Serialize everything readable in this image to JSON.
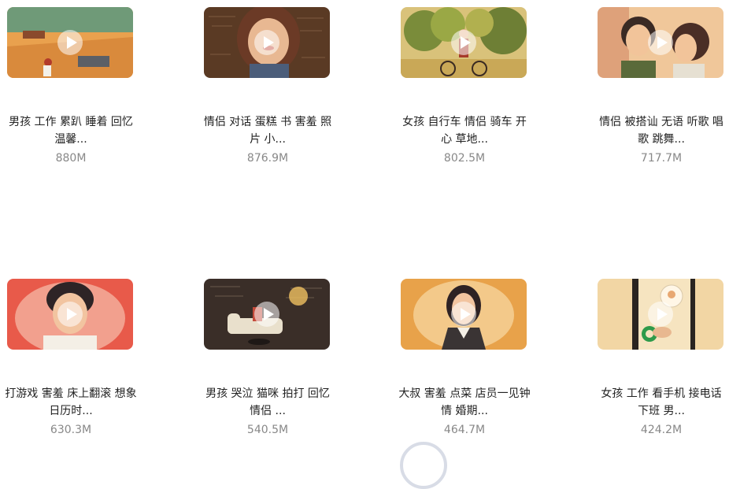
{
  "videos": [
    {
      "title_line1": "男孩 工作 累趴 睡着 回忆",
      "title_line2": "温馨...",
      "size": "880M",
      "icon": "play-icon"
    },
    {
      "title_line1": "情侣 对话 蛋糕 书 害羞 照",
      "title_line2": "片 小...",
      "size": "876.9M",
      "icon": "play-icon"
    },
    {
      "title_line1": "女孩 自行车 情侣 骑车 开",
      "title_line2": "心 草地...",
      "size": "802.5M",
      "icon": "play-icon"
    },
    {
      "title_line1": "情侣 被搭讪 无语 听歌 唱",
      "title_line2": "歌 跳舞...",
      "size": "717.7M",
      "icon": "play-icon"
    },
    {
      "title_line1": "打游戏 害羞 床上翻滚 想象",
      "title_line2": "日历时...",
      "size": "630.3M",
      "icon": "play-icon"
    },
    {
      "title_line1": "男孩 哭泣 猫咪 拍打 回忆",
      "title_line2": "情侣 ...",
      "size": "540.5M",
      "icon": "play-icon"
    },
    {
      "title_line1": "大叔 害羞 点菜 店员一见钟",
      "title_line2": "情 婚期...",
      "size": "464.7M",
      "icon": "play-icon"
    },
    {
      "title_line1": "女孩 工作 看手机 接电话",
      "title_line2": "下班 男...",
      "size": "424.2M",
      "icon": "play-icon"
    }
  ]
}
